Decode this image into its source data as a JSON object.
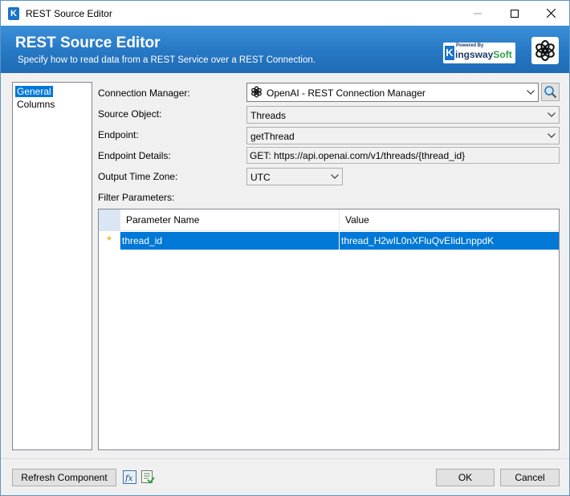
{
  "window": {
    "title": "REST Source Editor",
    "app_icon_letter": "K",
    "controls": [
      "minimize-icon",
      "maximize-icon",
      "close-icon"
    ]
  },
  "banner": {
    "title": "REST Source Editor",
    "subtitle": "Specify how to read data from a REST Service over a REST Connection.",
    "logo_powered": "Powered By",
    "logo_letter": "K",
    "logo_name_main": "ingsway",
    "logo_name_accent": "Soft"
  },
  "nav": {
    "items": [
      {
        "label": "General",
        "selected": true
      },
      {
        "label": "Columns",
        "selected": false
      }
    ]
  },
  "form": {
    "connection_manager": {
      "label": "Connection Manager:",
      "value": "OpenAI - REST Connection Manager",
      "icon": "openai-icon"
    },
    "source_object": {
      "label": "Source Object:",
      "value": "Threads"
    },
    "endpoint": {
      "label": "Endpoint:",
      "value": "getThread"
    },
    "endpoint_details": {
      "label": "Endpoint Details:",
      "value": "GET: https://api.openai.com/v1/threads/{thread_id}"
    },
    "output_time_zone": {
      "label": "Output Time Zone:",
      "value": "UTC"
    },
    "filter_parameters_label": "Filter Parameters:"
  },
  "grid": {
    "columns": [
      "Parameter Name",
      "Value"
    ],
    "rows": [
      {
        "marker": "*",
        "name": "thread_id",
        "value": "thread_H2wIL0nXFluQvEIidLnppdK"
      }
    ]
  },
  "footer": {
    "refresh_label": "Refresh Component",
    "ok_label": "OK",
    "cancel_label": "Cancel"
  },
  "colors": {
    "banner": "#2778c4",
    "selection": "#0078d7",
    "new_row_marker": "#e8a700"
  }
}
